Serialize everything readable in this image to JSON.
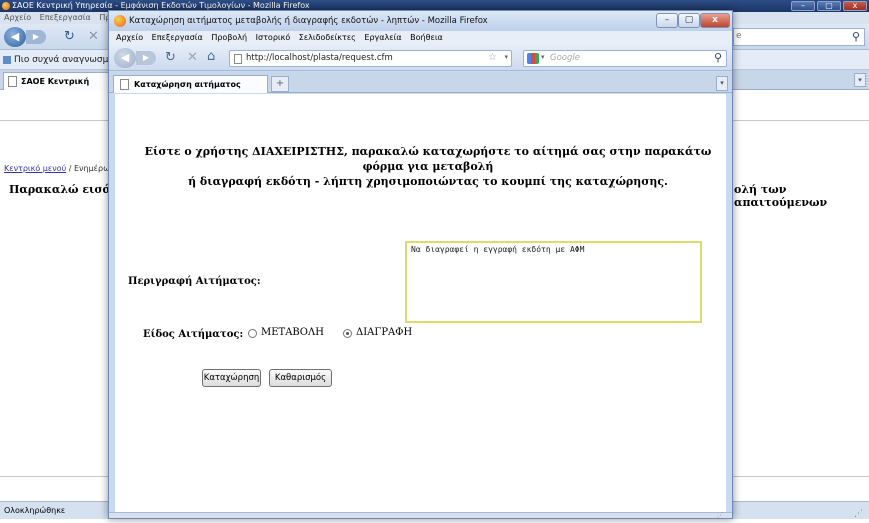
{
  "background_window": {
    "title": "ΣΑΟΕ Κεντρική Υπηρεσία - Εμφάνιση Εκδοτών Τιμολογίων - Mozilla Firefox",
    "menu": [
      "Αρχείο",
      "Επεξεργασία",
      "Προβ"
    ],
    "url_tail": "e",
    "bookmarks_item": "Πιο συχνά αναγνωσμέ...",
    "tab_label": "ΣΑΟΕ Κεντρική Υπηρε",
    "breadcrumb": {
      "link": "Κεντρικό μενού",
      "separator": "/",
      "current": "Ενημέρωση"
    },
    "line_start": "Παρακαλώ εισάγετ",
    "line_end": "ολή των απαιτούμενων",
    "status": "Ολοκληρώθηκε"
  },
  "popup_window": {
    "title": "Καταχώρηση αιτήματος μεταβολής ή διαγραφής εκδοτών - ληπτών - Mozilla Firefox",
    "controls": {
      "minimize": "–",
      "maximize": "▢",
      "close": "x"
    },
    "menu": [
      "Αρχείο",
      "Επεξεργασία",
      "Προβολή",
      "Ιστορικό",
      "Σελιδοδείκτες",
      "Εργαλεία",
      "Βοήθεια"
    ],
    "url": "http://localhost/plasta/request.cfm",
    "search_placeholder": "Google",
    "tab_label": "Καταχώρηση αιτήματος μεταβολ...",
    "new_tab": "+"
  },
  "form": {
    "heading_line1": "Είστε ο χρήστης ΔΙΑΧΕΙΡΙΣΤΗΣ, παρακαλώ καταχωρήστε το αίτημά σας στην παρακάτω φόρμα για μεταβολή",
    "heading_line2": "ή διαγραφή εκδότη - λήπτη χρησιμοποιώντας το κουμπί της καταχώρησης.",
    "description_label": "Περιγραφή Αιτήματος:",
    "description_value": "Να διαγραφεί η εγγραφή εκδότη με ΑΦΜ",
    "type_label": "Είδος Αιτήματος:",
    "type_options": [
      {
        "label": "ΜΕΤΑΒΟΛΗ",
        "checked": false
      },
      {
        "label": "ΔΙΑΓΡΑΦΗ",
        "checked": true
      }
    ],
    "submit_label": "Καταχώρηση",
    "reset_label": "Καθαρισμός"
  },
  "colors": {
    "textarea_border": "#e0da6a",
    "link": "#3333aa",
    "titlebar": "#2d4d86"
  }
}
